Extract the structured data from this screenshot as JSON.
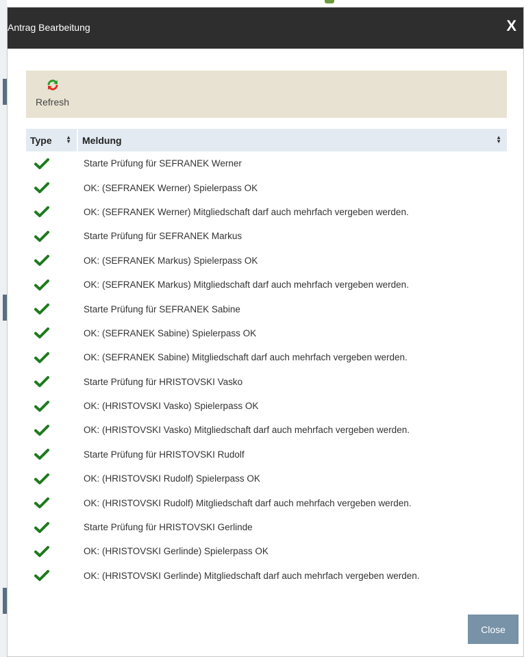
{
  "dialog": {
    "title": "Antrag Bearbeitung",
    "close_icon_label": "X"
  },
  "toolbar": {
    "refresh_label": "Refresh"
  },
  "table": {
    "columns": [
      "Type",
      "Meldung"
    ],
    "rows": [
      {
        "type": "check-icon",
        "message": "Starte Prüfung für SEFRANEK Werner"
      },
      {
        "type": "check-icon",
        "message": "OK: (SEFRANEK Werner) Spielerpass OK"
      },
      {
        "type": "check-icon",
        "message": "OK: (SEFRANEK Werner) Mitgliedschaft darf auch mehrfach vergeben werden."
      },
      {
        "type": "check-icon",
        "message": "Starte Prüfung für SEFRANEK Markus"
      },
      {
        "type": "check-icon",
        "message": "OK: (SEFRANEK Markus) Spielerpass OK"
      },
      {
        "type": "check-icon",
        "message": "OK: (SEFRANEK Markus) Mitgliedschaft darf auch mehrfach vergeben werden."
      },
      {
        "type": "check-icon",
        "message": "Starte Prüfung für SEFRANEK Sabine"
      },
      {
        "type": "check-icon",
        "message": "OK: (SEFRANEK Sabine) Spielerpass OK"
      },
      {
        "type": "check-icon",
        "message": "OK: (SEFRANEK Sabine) Mitgliedschaft darf auch mehrfach vergeben werden."
      },
      {
        "type": "check-icon",
        "message": "Starte Prüfung für HRISTOVSKI Vasko"
      },
      {
        "type": "check-icon",
        "message": "OK: (HRISTOVSKI Vasko) Spielerpass OK"
      },
      {
        "type": "check-icon",
        "message": "OK: (HRISTOVSKI Vasko) Mitgliedschaft darf auch mehrfach vergeben werden."
      },
      {
        "type": "check-icon",
        "message": "Starte Prüfung für HRISTOVSKI Rudolf"
      },
      {
        "type": "check-icon",
        "message": "OK: (HRISTOVSKI Rudolf) Spielerpass OK"
      },
      {
        "type": "check-icon",
        "message": "OK: (HRISTOVSKI Rudolf) Mitgliedschaft darf auch mehrfach vergeben werden."
      },
      {
        "type": "check-icon",
        "message": "Starte Prüfung für HRISTOVSKI Gerlinde"
      },
      {
        "type": "check-icon",
        "message": "OK: (HRISTOVSKI Gerlinde) Spielerpass OK"
      },
      {
        "type": "check-icon",
        "message": "OK: (HRISTOVSKI Gerlinde) Mitgliedschaft darf auch mehrfach vergeben werden."
      }
    ]
  },
  "footer": {
    "close_label": "Close"
  },
  "colors": {
    "titlebar": "#2e2e2e",
    "toolbar": "#e8e2d2",
    "header": "#e3eaf2",
    "check": "#1e7a1e",
    "close_button": "#7892a8"
  }
}
